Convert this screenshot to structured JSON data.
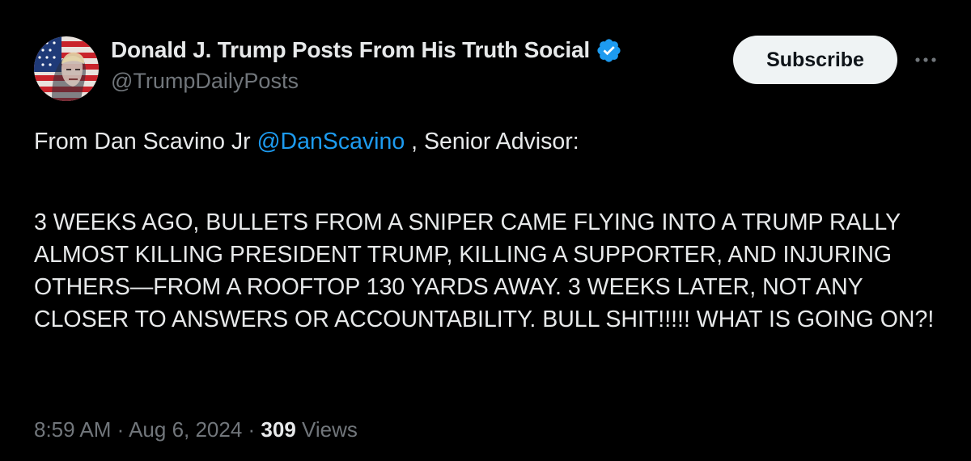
{
  "author": {
    "display_name": "Donald J. Trump Posts From His Truth Social",
    "handle": "@TrumpDailyPosts",
    "verified_icon": "verified-badge-icon",
    "verified_color": "#1d9bf0"
  },
  "actions": {
    "subscribe_label": "Subscribe",
    "more_icon": "more-horizontal-icon"
  },
  "post": {
    "line1_prefix": "From Dan Scavino Jr ",
    "mention": "@DanScavino",
    "line1_suffix": " , Senior Advisor:",
    "body": "3 WEEKS AGO, BULLETS FROM A SNIPER CAME FLYING INTO A TRUMP RALLY ALMOST KILLING PRESIDENT TRUMP, KILLING A SUPPORTER, AND INJURING OTHERS—FROM A ROOFTOP 130 YARDS AWAY. 3 WEEKS LATER, NOT ANY CLOSER TO ANSWERS OR ACCOUNTABILITY. BULL SHIT!!!!! WHAT IS GOING ON?!"
  },
  "meta": {
    "time": "8:59 AM",
    "separator": " · ",
    "date": "Aug 6, 2024",
    "views_count": "309",
    "views_label": " Views"
  },
  "colors": {
    "background": "#000000",
    "text": "#e7e9ea",
    "secondary_text": "#71767b",
    "link": "#1d9bf0",
    "button_bg": "#eff3f4"
  }
}
